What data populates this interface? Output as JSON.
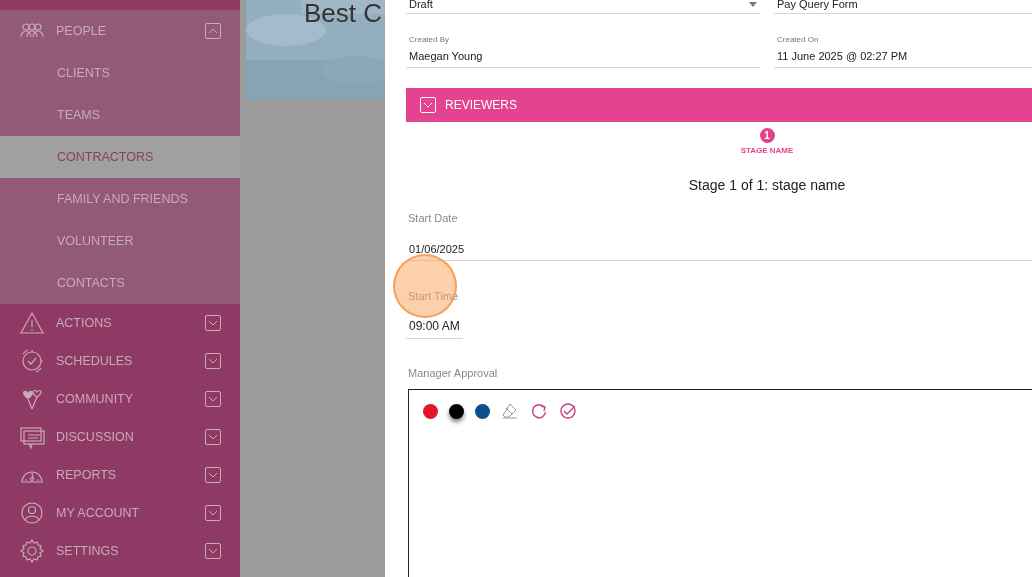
{
  "sidebar": {
    "items": [
      {
        "label": "PEOPLE",
        "expanded": true,
        "children": [
          {
            "label": "CLIENTS",
            "selected": false
          },
          {
            "label": "TEAMS",
            "selected": false
          },
          {
            "label": "CONTRACTORS",
            "selected": true
          },
          {
            "label": "FAMILY AND FRIENDS",
            "selected": false
          },
          {
            "label": "VOLUNTEER",
            "selected": false
          },
          {
            "label": "CONTACTS",
            "selected": false
          }
        ]
      },
      {
        "label": "ACTIONS",
        "expanded": false
      },
      {
        "label": "SCHEDULES",
        "expanded": false
      },
      {
        "label": "COMMUNITY",
        "expanded": false
      },
      {
        "label": "DISCUSSION",
        "expanded": false
      },
      {
        "label": "REPORTS",
        "expanded": false
      },
      {
        "label": "MY ACCOUNT",
        "expanded": false
      },
      {
        "label": "SETTINGS",
        "expanded": false
      }
    ]
  },
  "background": {
    "heading": "Best C"
  },
  "form": {
    "status": {
      "value": "Draft"
    },
    "form_name": {
      "value": "Pay Query Form"
    },
    "created_by": {
      "label": "Created By",
      "value": "Maegan Young"
    },
    "created_on": {
      "label": "Created On",
      "value": "11 June 2025 @ 02:27 PM"
    },
    "reviewers": {
      "title": "REVIEWERS",
      "expanded": false
    },
    "stages": [
      {
        "number": "1",
        "name": "STAGE NAME",
        "selected": true
      }
    ],
    "stage_title": "Stage 1 of 1: stage name",
    "start_date": {
      "label": "Start Date",
      "value": "01/06/2025"
    },
    "start_time": {
      "label": "Start Time",
      "value": "09:00 AM"
    },
    "signature": {
      "label": "Manager Approval",
      "pens": [
        {
          "color": "#e0162b",
          "selected": false
        },
        {
          "color": "#000000",
          "selected": true
        },
        {
          "color": "#0b4f8c",
          "selected": false
        }
      ],
      "tools": [
        {
          "kind": "eraser"
        },
        {
          "kind": "redo"
        },
        {
          "kind": "done"
        }
      ]
    }
  }
}
